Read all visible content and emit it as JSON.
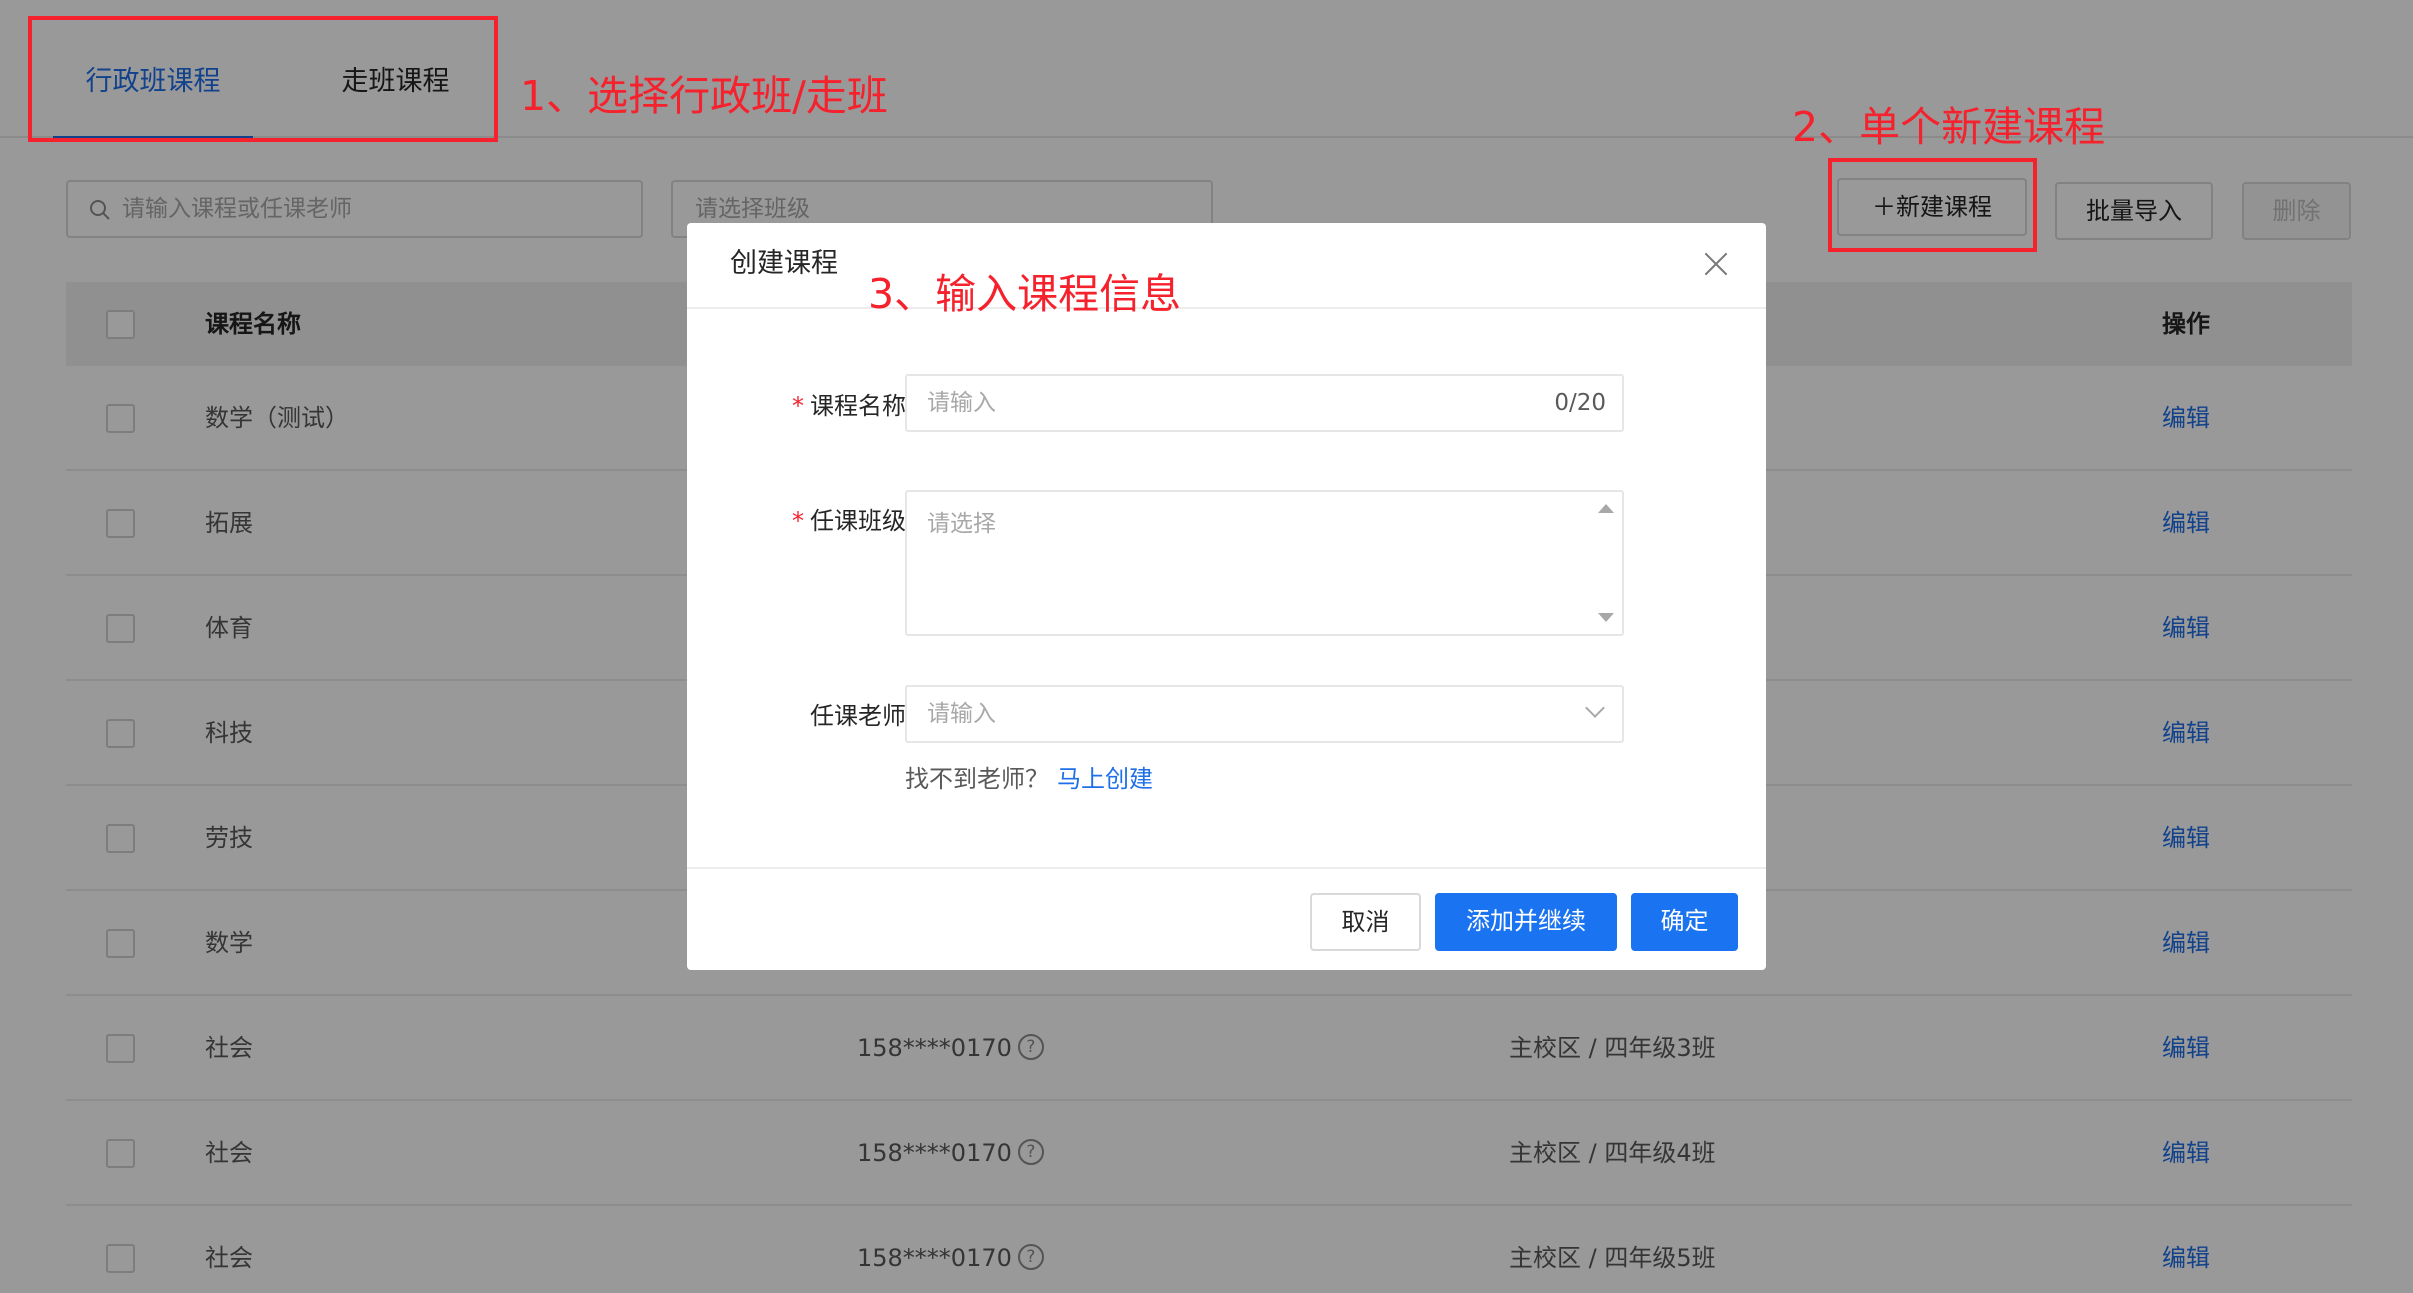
{
  "tabs": [
    {
      "label": "行政班课程"
    },
    {
      "label": "走班课程"
    }
  ],
  "filters": {
    "search_placeholder": "请输入课程或任课老师",
    "class_placeholder": "请选择班级"
  },
  "toolbar": {
    "new_label": "＋新建课程",
    "import_label": "批量导入",
    "delete_label": "删除"
  },
  "table": {
    "col_name": "课程名称",
    "col_ops": "操作",
    "rows": [
      {
        "name": "数学（测试）",
        "phone": "",
        "class": "",
        "action": "编辑"
      },
      {
        "name": "拓展",
        "phone": "",
        "class": "",
        "action": "编辑"
      },
      {
        "name": "体育",
        "phone": "",
        "class": "",
        "action": "编辑"
      },
      {
        "name": "科技",
        "phone": "",
        "class": "",
        "action": "编辑"
      },
      {
        "name": "劳技",
        "phone": "",
        "class": "",
        "action": "编辑"
      },
      {
        "name": "数学",
        "phone": "",
        "class": "",
        "action": "编辑"
      },
      {
        "name": "社会",
        "phone": "158****0170",
        "class": "主校区 / 四年级3班",
        "action": "编辑"
      },
      {
        "name": "社会",
        "phone": "158****0170",
        "class": "主校区 / 四年级4班",
        "action": "编辑"
      },
      {
        "name": "社会",
        "phone": "158****0170",
        "class": "主校区 / 四年级5班",
        "action": "编辑"
      }
    ]
  },
  "modal": {
    "title": "创建课程",
    "name_label": "课程名称：",
    "name_placeholder": "请输入",
    "name_count": "0/20",
    "class_label": "任课班级：",
    "class_placeholder": "请选择",
    "teacher_label": "任课老师：",
    "teacher_placeholder": "请输入",
    "hint_text": "找不到老师？",
    "hint_link": "马上创建",
    "cancel_label": "取消",
    "continue_label": "添加并继续",
    "ok_label": "确定"
  },
  "annotations": {
    "step1": "1、选择行政班/走班",
    "step2": "2、单个新建课程",
    "step3": "3、输入课程信息"
  },
  "colors": {
    "primary": "#1a73f0",
    "annotation": "#f5222d",
    "required": "#f5222d"
  }
}
